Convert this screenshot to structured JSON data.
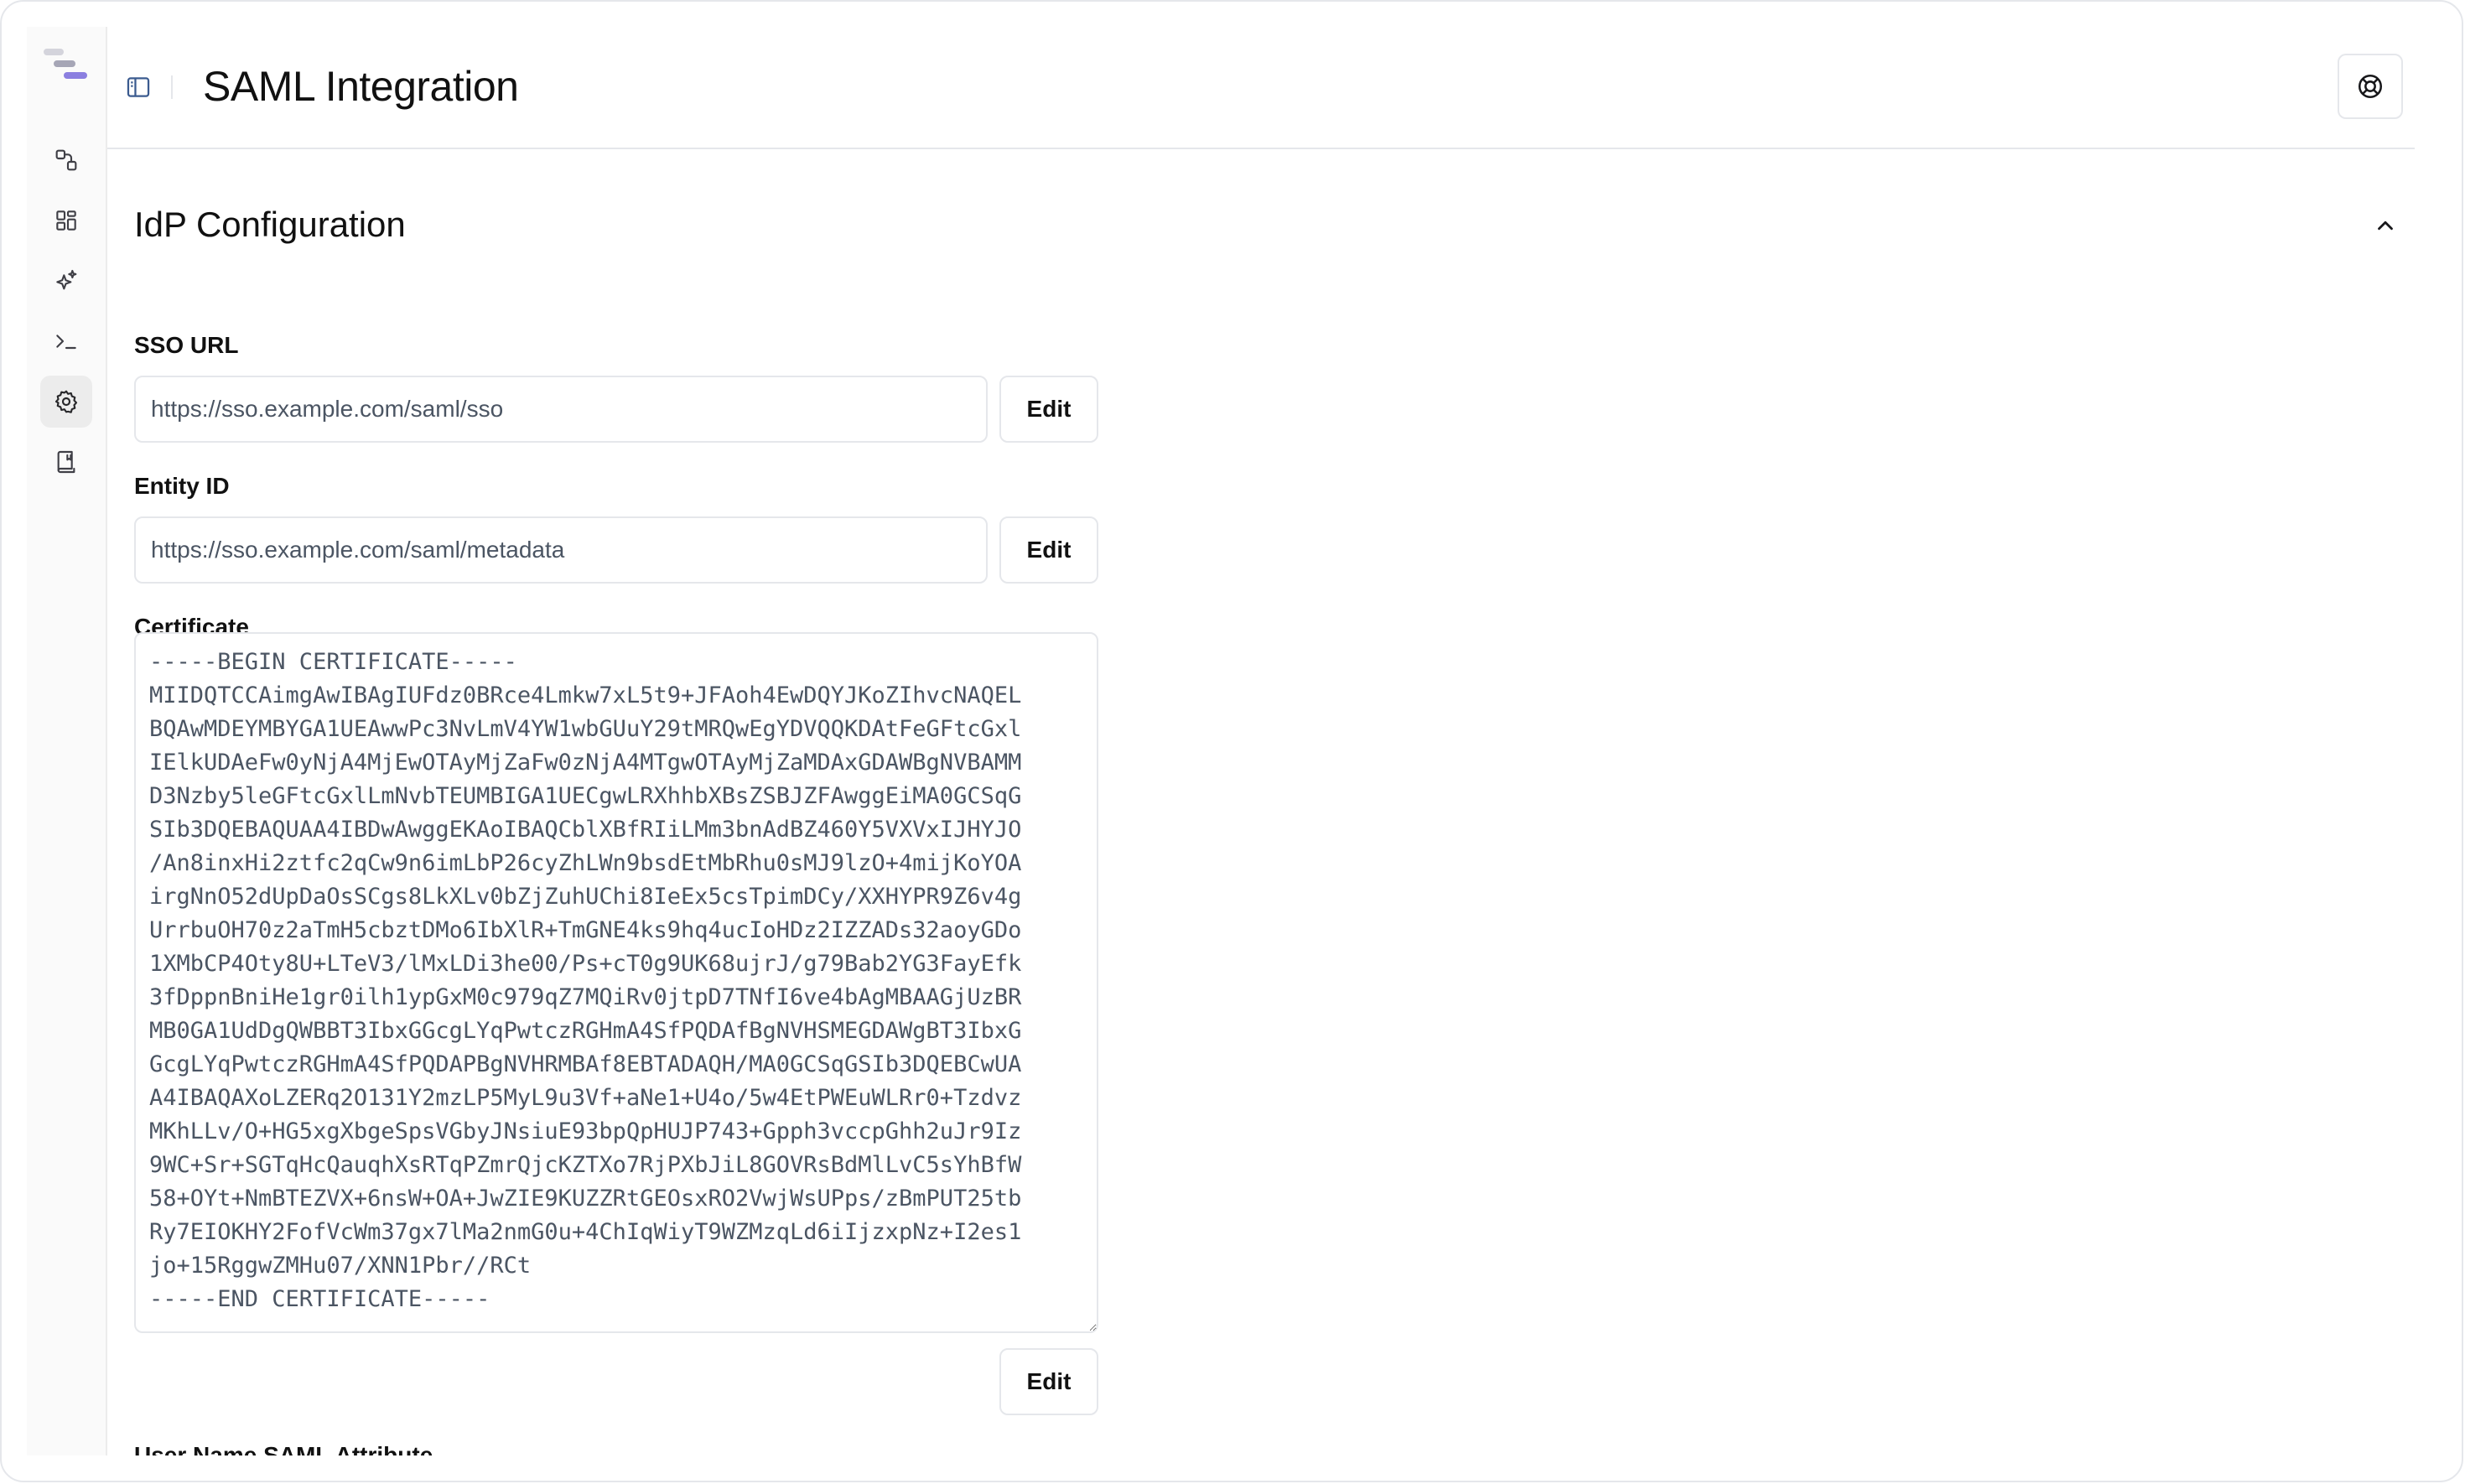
{
  "header": {
    "title": "SAML Integration",
    "toggle_icon": "sidebar-toggle-icon",
    "help_icon": "lifebuoy-icon"
  },
  "sidebar": {
    "logo_colors": [
      "#d4d4dc",
      "#a6a6b6",
      "#8b7fe0"
    ],
    "items": [
      {
        "name": "integrations",
        "icon": "integrations-icon"
      },
      {
        "name": "dashboard",
        "icon": "dashboard-icon"
      },
      {
        "name": "ai",
        "icon": "sparkles-icon"
      },
      {
        "name": "terminal",
        "icon": "terminal-icon"
      },
      {
        "name": "settings",
        "icon": "gear-icon",
        "active": true
      },
      {
        "name": "docs",
        "icon": "book-icon"
      }
    ]
  },
  "section": {
    "title": "IdP Configuration",
    "collapse_icon": "chevron-up-icon"
  },
  "fields": {
    "sso_url": {
      "label": "SSO URL",
      "value": "https://sso.example.com/saml/sso",
      "edit": "Edit"
    },
    "entity_id": {
      "label": "Entity ID",
      "value": "https://sso.example.com/saml/metadata",
      "edit": "Edit"
    },
    "certificate": {
      "label": "Certificate",
      "value": "-----BEGIN CERTIFICATE-----\nMIIDQTCCAimgAwIBAgIUFdz0BRce4Lmkw7xL5t9+JFAoh4EwDQYJKoZIhvcNAQEL\nBQAwMDEYMBYGA1UEAwwPc3NvLmV4YW1wbGUuY29tMRQwEgYDVQQKDAtFeGFtcGxl\nIElkUDAeFw0yNjA4MjEwOTAyMjZaFw0zNjA4MTgwOTAyMjZaMDAxGDAWBgNVBAMM\nD3Nzby5leGFtcGxlLmNvbTEUMBIGA1UECgwLRXhhbXBsZSBJZFAwggEiMA0GCSqG\nSIb3DQEBAQUAA4IBDwAwggEKAoIBAQCblXBfRIiLMm3bnAdBZ460Y5VXVxIJHYJO\n/An8inxHi2ztfc2qCw9n6imLbP26cyZhLWn9bsdEtMbRhu0sMJ9lzO+4mijKoYOA\nirgNnO52dUpDaOsSCgs8LkXLv0bZjZuhUChi8IeEx5csTpimDCy/XXHYPR9Z6v4g\nUrrbuOH70z2aTmH5cbztDMo6IbXlR+TmGNE4ks9hq4ucIoHDz2IZZADs32aoyGDo\n1XMbCP4Oty8U+LTeV3/lMxLDi3he00/Ps+cT0g9UK68ujrJ/g79Bab2YG3FayEfk\n3fDppnBniHe1gr0ilh1ypGxM0c979qZ7MQiRv0jtpD7TNfI6ve4bAgMBAAGjUzBR\nMB0GA1UdDgQWBBT3IbxGGcgLYqPwtczRGHmA4SfPQDAfBgNVHSMEGDAWgBT3IbxG\nGcgLYqPwtczRGHmA4SfPQDAPBgNVHRMBAf8EBTADAQH/MA0GCSqGSIb3DQEBCwUA\nA4IBAQAXoLZERq2O131Y2mzLP5MyL9u3Vf+aNe1+U4o/5w4EtPWEuWLRr0+Tzdvz\nMKhLLv/O+HG5xgXbgeSpsVGbyJNsiuE93bpQpHUJP743+Gpph3vccpGhh2uJr9Iz\n9WC+Sr+SGTqHcQauqhXsRTqPZmrQjcKZTXo7RjPXbJiL8GOVRsBdMlLvC5sYhBfW\n58+OYt+NmBTEZVX+6nsW+OA+JwZIE9KUZZRtGEOsxRO2VwjWsUPps/zBmPUT25tb\nRy7EIOKHY2FofVcWm37gx7lMa2nmG0u+4ChIqWiyT9WZMzqLd6iIjzxpNz+I2es1\njo+15RggwZMHu07/XNN1Pbr//RCt\n-----END CERTIFICATE-----",
      "edit": "Edit"
    },
    "username_attr": {
      "label": "User Name SAML Attribute"
    }
  }
}
